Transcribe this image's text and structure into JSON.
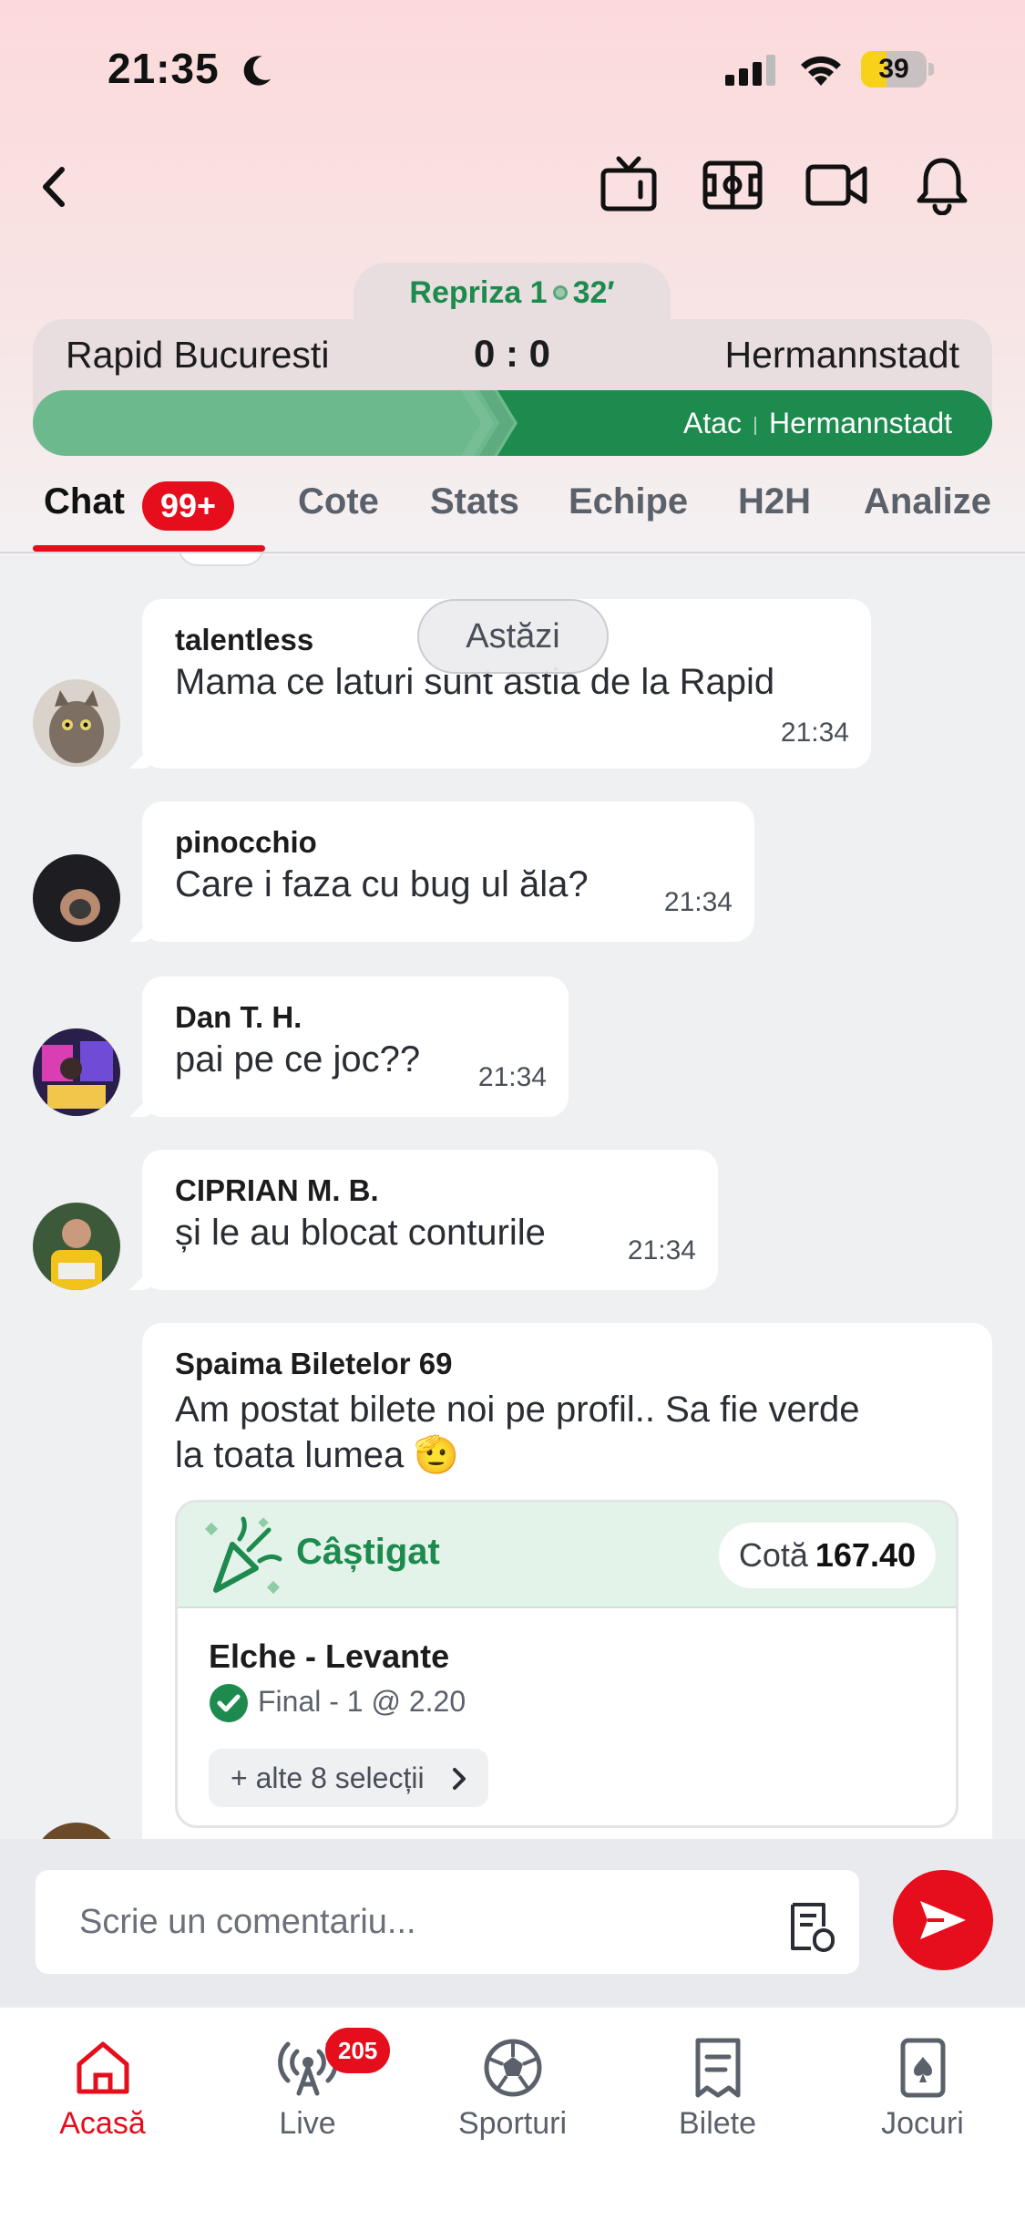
{
  "status_bar": {
    "time": "21:35",
    "battery": "39",
    "battery_level": 0.39
  },
  "match": {
    "period": "Repriza 1",
    "minute": "32′",
    "home_team": "Rapid Bucuresti",
    "away_team": "Hermannstadt",
    "score": "0 : 0",
    "pressure_label": "Atac",
    "pressure_team": "Hermannstadt"
  },
  "tabs": [
    {
      "label": "Chat",
      "badge": "99+"
    },
    {
      "label": "Cote"
    },
    {
      "label": "Stats"
    },
    {
      "label": "Echipe"
    },
    {
      "label": "H2H"
    },
    {
      "label": "Analize"
    }
  ],
  "chat": {
    "date_pill": "Astăzi",
    "messages": [
      {
        "user": "talentless",
        "text": "Mama ce laturi sunt astia de la Rapid",
        "time": "21:34"
      },
      {
        "user": "pinocchio",
        "text": "Care i faza cu bug ul ăla?",
        "time": "21:34"
      },
      {
        "user": "Dan T. H.",
        "text": "pai pe ce joc??",
        "time": "21:34"
      },
      {
        "user": "CIPRIAN M. B.",
        "text": "și le au blocat conturile",
        "time": "21:34"
      },
      {
        "user": "Spaima Biletelor 69",
        "text_line1": "Am postat bilete noi pe profil.. Sa fie verde",
        "text_line2": "la toata lumea 🫡"
      }
    ],
    "ticket": {
      "status": "Câștigat",
      "odds_label": "Cotă",
      "odds_value": "167.40",
      "match": "Elche - Levante",
      "selection": "Final - 1 @ 2.20",
      "more": "+ alte 8 selecții"
    }
  },
  "comment": {
    "placeholder": "Scrie un comentariu..."
  },
  "bottom_nav": [
    {
      "label": "Acasă",
      "icon": "home-icon",
      "active": true
    },
    {
      "label": "Live",
      "icon": "broadcast-icon",
      "badge": "205"
    },
    {
      "label": "Sporturi",
      "icon": "soccer-ball-icon"
    },
    {
      "label": "Bilete",
      "icon": "ticket-icon"
    },
    {
      "label": "Jocuri",
      "icon": "cards-icon"
    }
  ],
  "colors": {
    "accent": "#e60d1c",
    "green": "#1d8a4e"
  }
}
